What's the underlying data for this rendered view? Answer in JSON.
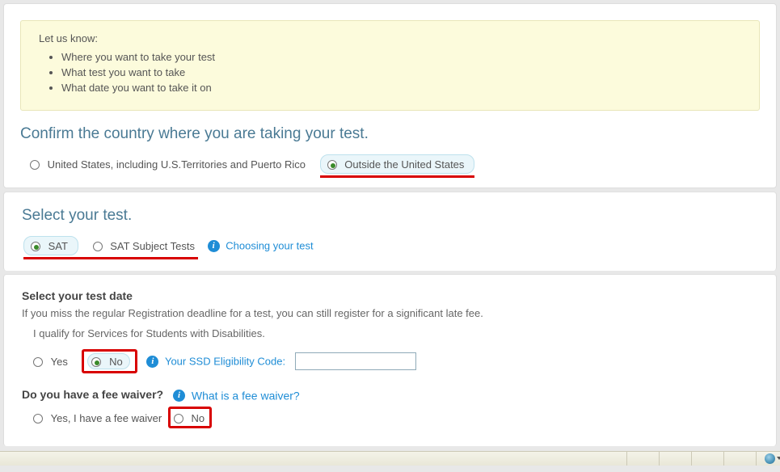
{
  "info": {
    "lead": "Let us know:",
    "bullets": [
      "Where you want to take your test",
      "What test you want to take",
      "What date you want to take it on"
    ]
  },
  "country": {
    "heading": "Confirm the country where you are taking your test.",
    "options": [
      {
        "label": "United States, including U.S.Territories and Puerto Rico",
        "checked": false
      },
      {
        "label": "Outside the United States",
        "checked": true
      }
    ]
  },
  "test": {
    "heading": "Select your test.",
    "options": [
      {
        "label": "SAT",
        "checked": true
      },
      {
        "label": "SAT Subject Tests",
        "checked": false
      }
    ],
    "help_link": "Choosing your test"
  },
  "date": {
    "heading": "Select your test date",
    "desc": "If you miss the regular Registration deadline for a test, you can still register for a significant late fee.",
    "ssd_label": "I qualify for Services for Students with Disabilities.",
    "ssd_options": [
      {
        "label": "Yes",
        "checked": false
      },
      {
        "label": "No",
        "checked": true
      }
    ],
    "ssd_code_label": "Your SSD Eligibility Code:",
    "ssd_code_value": "",
    "fee_question": "Do you have a fee waiver?",
    "fee_help_link": "What is a fee waiver?",
    "fee_options": [
      {
        "label": "Yes, I have a fee waiver",
        "checked": false
      },
      {
        "label": "No",
        "checked": false
      }
    ]
  }
}
